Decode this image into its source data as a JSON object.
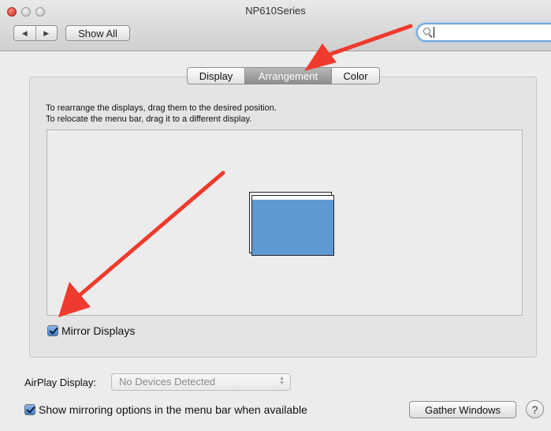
{
  "window": {
    "title": "NP610Series"
  },
  "toolbar": {
    "back_icon": "◀",
    "forward_icon": "▶",
    "show_all_label": "Show All",
    "search": {
      "value": "",
      "placeholder": ""
    }
  },
  "tabs": [
    {
      "label": "Display",
      "selected": false
    },
    {
      "label": "Arrangement",
      "selected": true
    },
    {
      "label": "Color",
      "selected": false
    }
  ],
  "arrangement": {
    "instruction_line1": "To rearrange the displays, drag them to the desired position.",
    "instruction_line2": "To relocate the menu bar, drag it to a different display.",
    "display_color": "#5f99d3",
    "mirror_displays": {
      "label": "Mirror Displays",
      "checked": true
    }
  },
  "airplay": {
    "label": "AirPlay Display:",
    "selected_option": "No Devices Detected",
    "enabled": false
  },
  "show_mirroring": {
    "label": "Show mirroring options in the menu bar when available",
    "checked": true
  },
  "gather_windows_label": "Gather Windows",
  "help_label": "?",
  "colors": {
    "annotation_arrow": "#ef3b2d",
    "accent": "#6ea5e0"
  }
}
